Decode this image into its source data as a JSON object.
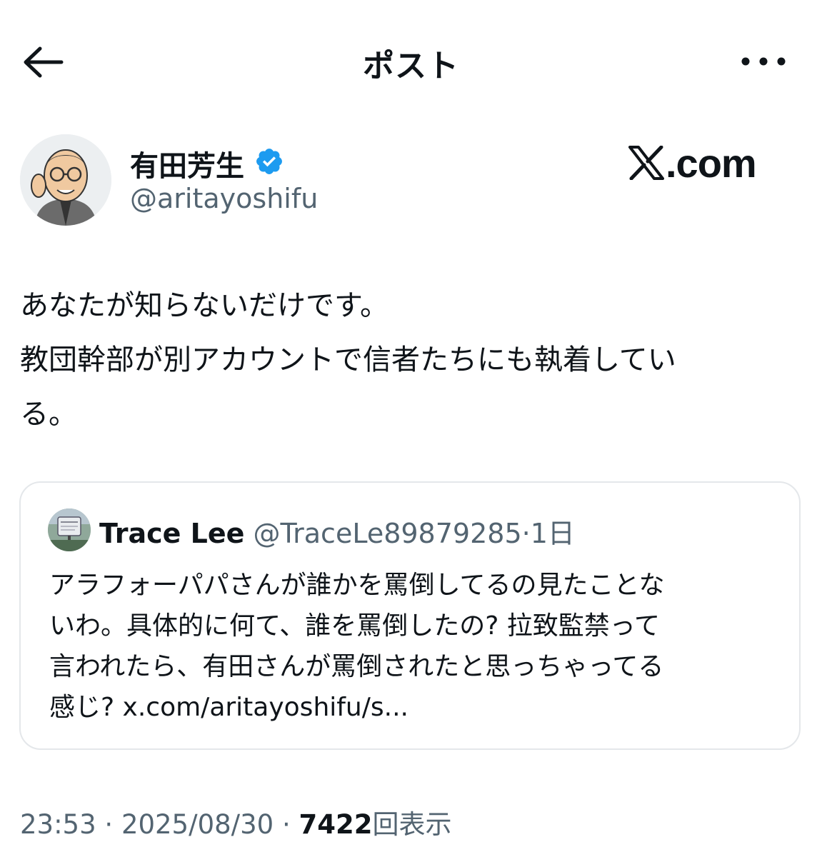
{
  "header": {
    "title": "ポスト"
  },
  "author": {
    "display_name": "有田芳生",
    "handle": "@aritayoshifu"
  },
  "brand": {
    "logo_text": ".com"
  },
  "post": {
    "lines": [
      "あなたが知らないだけです。",
      "教団幹部が別アカウントで信者たちにも執着してい",
      "る。"
    ]
  },
  "quoted_post": {
    "display_name": "Trace Lee",
    "handle": "@TraceLe89879285",
    "separator": "·",
    "age": "1日",
    "lines": [
      "アラフォーパパさんが誰かを罵倒してるの見たことな",
      "いわ。具体的に何て、誰を罵倒したの? 拉致監禁って",
      "言われたら、有田さんが罵倒されたと思っちゃってる",
      "感じ? x.com/aritayoshifu/s..."
    ]
  },
  "footer": {
    "time": "23:53",
    "sep1": " · ",
    "date": "2025/08/30",
    "sep2": " · ",
    "views": "7422",
    "views_label": "回表示"
  },
  "colors": {
    "verified": "#1d9bf0",
    "secondary_text": "#536471",
    "border": "#e4e7ea"
  },
  "icons": {
    "back": "arrow-left-icon",
    "more": "more-horizontal-icon",
    "verified": "verified-badge-icon",
    "x_logo": "x-logo-icon"
  }
}
